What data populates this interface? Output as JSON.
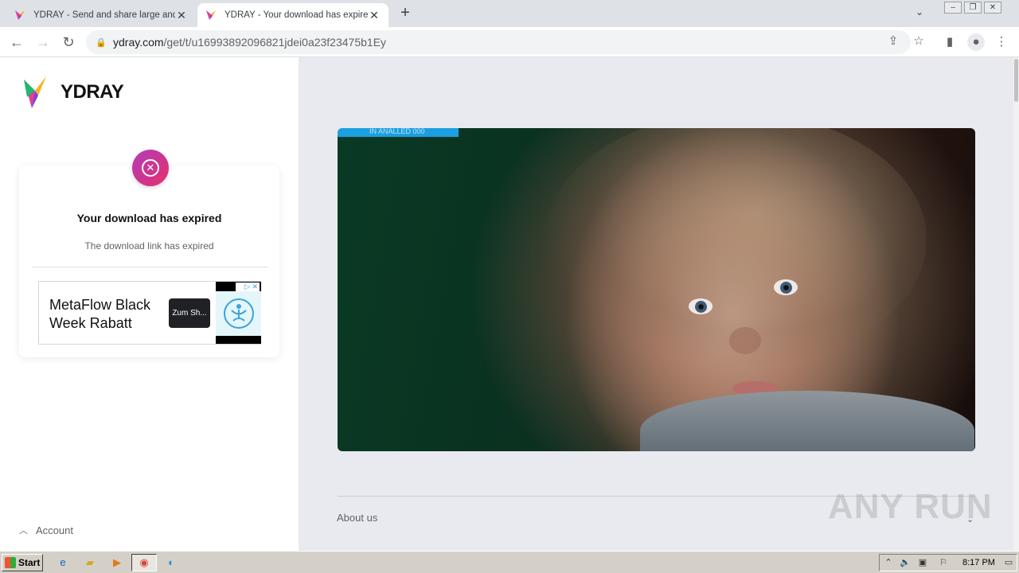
{
  "browser": {
    "tabs": [
      {
        "title": "YDRAY - Send and share large and b",
        "active": false
      },
      {
        "title": "YDRAY - Your download has expired",
        "active": true
      }
    ],
    "new_tab": "+",
    "url_host": "ydray.com",
    "url_path": "/get/t/u16993892096821jdei0a23f23475b1Ey"
  },
  "page": {
    "logo_text": "YDRAY",
    "status": {
      "title": "Your download has expired",
      "subtitle": "The download link has expired"
    },
    "ad": {
      "headline": "MetaFlow Black Week Rabatt",
      "button": "Zum Sh..."
    },
    "account_label": "Account",
    "hero_tag": "IN ANALLED 000",
    "about_label": "About us",
    "watermark": "ANY RUN"
  },
  "taskbar": {
    "start_label": "Start",
    "clock": "8:17 PM"
  },
  "colors": {
    "accent_gradient_start": "#b13cb9",
    "accent_gradient_end": "#e6306c",
    "right_panel_bg": "#e8eaef",
    "hero_tag": "#1a9fe0"
  }
}
